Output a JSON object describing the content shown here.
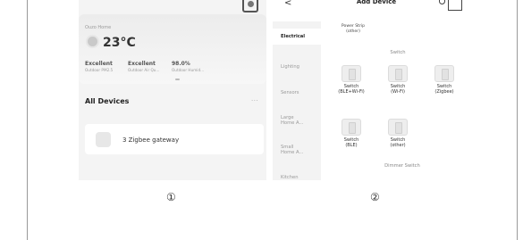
{
  "screen1": {
    "home_name": "Ouzo Home",
    "temperature": "23°C",
    "metrics": [
      {
        "value": "Excellent",
        "label": "Outdoor PM2.5"
      },
      {
        "value": "Excellent",
        "label": "Outdoor Air Qu..."
      },
      {
        "value": "98.0%",
        "label": "Outdoor Humid..."
      }
    ],
    "section_title": "All Devices",
    "more_label": "···",
    "device": {
      "name": "3 Zigbee gateway"
    }
  },
  "screen2": {
    "back_label": "<",
    "title": "Add Device",
    "categories": [
      {
        "label": "Electrical",
        "active": true
      },
      {
        "label": "Lighting",
        "active": false
      },
      {
        "label": "Sensors",
        "active": false
      },
      {
        "label": "Large\nHome A...",
        "active": false
      },
      {
        "label": "Small\nHome A...",
        "active": false
      },
      {
        "label": "Kitchen",
        "active": false
      }
    ],
    "power_strip": "Power Strip\n(other)",
    "section_switch": "Switch",
    "switches": [
      {
        "label": "Switch\n(BLE+Wi-Fi)"
      },
      {
        "label": "Switch\n(Wi-Fi)"
      },
      {
        "label": "Switch\n(Zigbee)"
      },
      {
        "label": "Switch\n(BLE)"
      },
      {
        "label": "Switch\n(other)"
      }
    ],
    "section_dimmer": "Dimmer Switch"
  },
  "captions": [
    "①",
    "②"
  ]
}
